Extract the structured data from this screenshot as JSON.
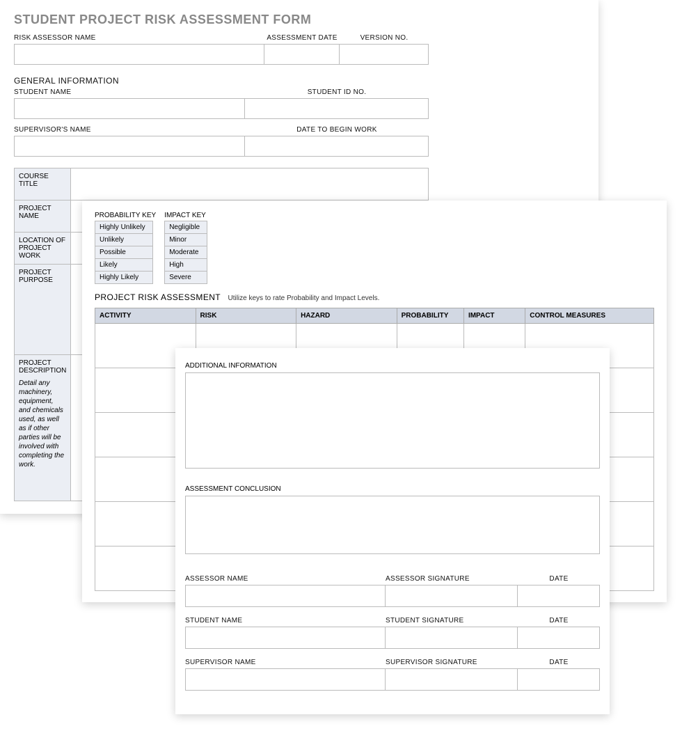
{
  "title": "STUDENT PROJECT RISK ASSESSMENT FORM",
  "header": {
    "assessor_name_label": "RISK ASSESSOR NAME",
    "assessment_date_label": "ASSESSMENT DATE",
    "version_no_label": "VERSION NO."
  },
  "general": {
    "section_label": "GENERAL INFORMATION",
    "student_name_label": "STUDENT NAME",
    "student_id_label": "STUDENT ID NO.",
    "supervisor_name_label": "SUPERVISOR'S NAME",
    "date_begin_label": "DATE TO BEGIN WORK"
  },
  "details": {
    "course_title_label": "COURSE TITLE",
    "project_name_label": "PROJECT NAME",
    "location_label": "LOCATION OF PROJECT WORK",
    "purpose_label": "PROJECT PURPOSE",
    "description_label": "PROJECT DESCRIPTION",
    "description_note": "Detail any machinery, equipment, and chemicals used, as well as if other parties will be involved with completing the work."
  },
  "keys": {
    "probability_label": "PROBABILITY KEY",
    "impact_label": "IMPACT KEY",
    "probability": [
      "Highly Unlikely",
      "Unlikely",
      "Possible",
      "Likely",
      "Highly Likely"
    ],
    "impact": [
      "Negligible",
      "Minor",
      "Moderate",
      "High",
      "Severe"
    ]
  },
  "assessment": {
    "title": "PROJECT RISK ASSESSMENT",
    "subtitle": "Utilize keys to rate Probability and Impact Levels.",
    "columns": [
      "ACTIVITY",
      "RISK",
      "HAZARD",
      "PROBABILITY",
      "IMPACT",
      "CONTROL MEASURES"
    ]
  },
  "page3": {
    "additional_info_label": "ADDITIONAL INFORMATION",
    "conclusion_label": "ASSESSMENT CONCLUSION",
    "sig": [
      {
        "name": "ASSESSOR NAME",
        "sig": "ASSESSOR SIGNATURE",
        "date": "DATE"
      },
      {
        "name": "STUDENT NAME",
        "sig": "STUDENT SIGNATURE",
        "date": "DATE"
      },
      {
        "name": "SUPERVISOR NAME",
        "sig": "SUPERVISOR SIGNATURE",
        "date": "DATE"
      }
    ]
  }
}
